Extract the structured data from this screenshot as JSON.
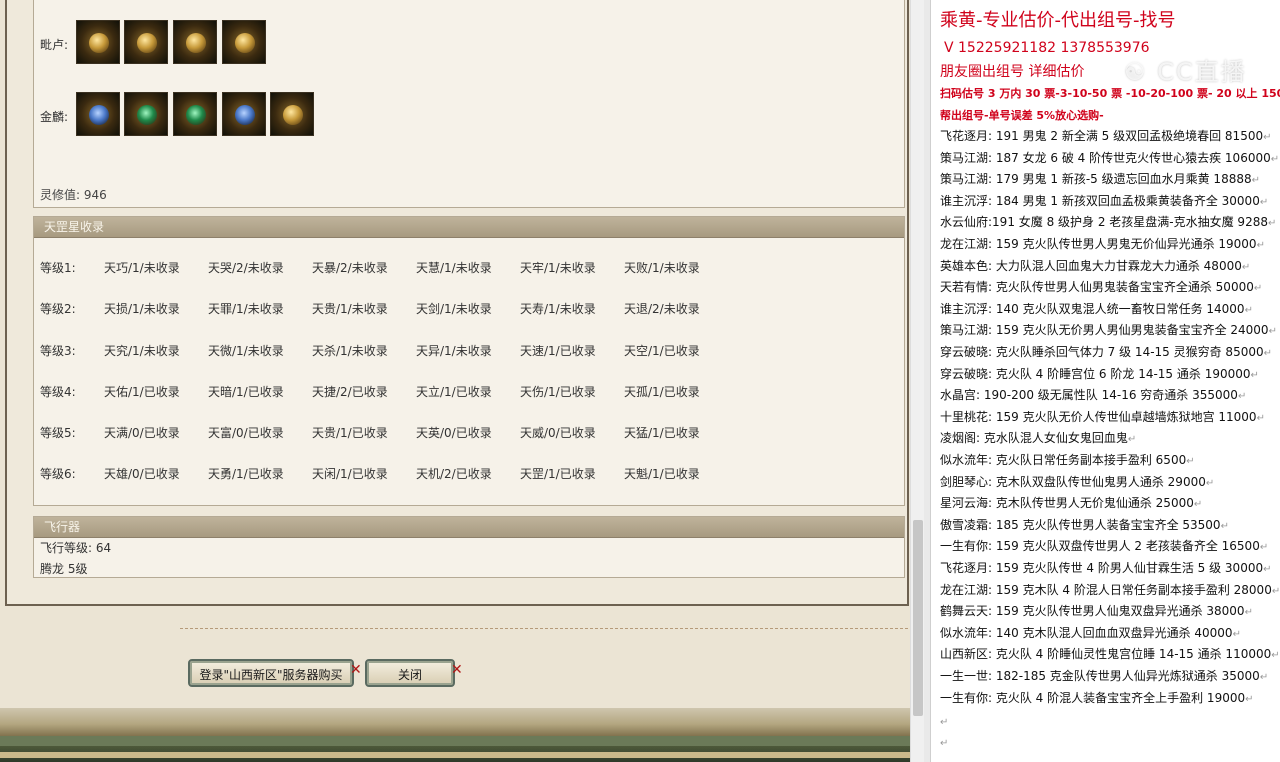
{
  "equipment": {
    "row1_label": "毗卢:",
    "row2_label": "金麟:",
    "lingxiu": "灵修值: 946"
  },
  "tiangang": {
    "title": "天罡星收录",
    "rows": [
      {
        "label": "等级1:",
        "cells": [
          "天巧/1/未收录",
          "天哭/2/未收录",
          "天暴/2/未收录",
          "天慧/1/未收录",
          "天牢/1/未收录",
          "天败/1/未收录"
        ]
      },
      {
        "label": "等级2:",
        "cells": [
          "天损/1/未收录",
          "天罪/1/未收录",
          "天贵/1/未收录",
          "天剑/1/未收录",
          "天寿/1/未收录",
          "天退/2/未收录"
        ]
      },
      {
        "label": "等级3:",
        "cells": [
          "天究/1/未收录",
          "天微/1/未收录",
          "天杀/1/未收录",
          "天异/1/未收录",
          "天速/1/已收录",
          "天空/1/已收录"
        ]
      },
      {
        "label": "等级4:",
        "cells": [
          "天佑/1/已收录",
          "天暗/1/已收录",
          "天捷/2/已收录",
          "天立/1/已收录",
          "天伤/1/已收录",
          "天孤/1/已收录"
        ]
      },
      {
        "label": "等级5:",
        "cells": [
          "天满/0/已收录",
          "天富/0/已收录",
          "天贵/1/已收录",
          "天英/0/已收录",
          "天威/0/已收录",
          "天猛/1/已收录"
        ]
      },
      {
        "label": "等级6:",
        "cells": [
          "天雄/0/已收录",
          "天勇/1/已收录",
          "天闲/1/已收录",
          "天机/2/已收录",
          "天罡/1/已收录",
          "天魁/1/已收录"
        ]
      }
    ]
  },
  "feixing": {
    "title": "飞行器",
    "level": "飞行等级: 64",
    "mount": "腾龙   5级"
  },
  "buttons": {
    "login": "登录\"山西新区\"服务器购买",
    "close": "关闭",
    "x": "✕"
  },
  "notes": {
    "title": "乘黄-专业估价-代出组号-找号",
    "phone": "V 15225921182   1378553976",
    "line3": "朋友圈出组号   详细估价",
    "line4": "扫码估号 3 万内 30 票-3-10-50 票  -10-20-100 票- 20 以上 150",
    "line5": "帮出组号-单号误差 5%放心选购-",
    "watermark": "☯ CC直播",
    "ret": "↵",
    "items": [
      "飞花逐月: 191 男鬼 2 新全满 5 级双回孟极绝境春回 81500",
      "策马江湖: 187 女龙 6 破 4 阶传世克火传世心猿去疾 106000",
      "策马江湖: 179 男鬼 1 新孩-5 级遗忘回血水月乘黄 18888",
      "谁主沉浮: 184 男鬼 1 新孩双回血孟极乘黄装备齐全 30000",
      "水云仙府:191 女魔 8 级护身 2 老孩星盘满-克水抽女魔 9288",
      "龙在江湖: 159 克火队传世男人男鬼无价仙异光通杀 19000",
      "英雄本色: 大力队混人回血鬼大力甘霖龙大力通杀 48000",
      "天若有情: 克火队传世男人仙男鬼装备宝宝齐全通杀 50000",
      "谁主沉浮: 140 克火队双鬼混人统一畜牧日常任务 14000",
      "策马江湖: 159 克火队无价男人男仙男鬼装备宝宝齐全 24000",
      "穿云破晓: 克火队睡杀回气体力 7 级 14-15 灵猴穷奇 85000",
      "穿云破晓: 克火队 4 阶睡宫位 6 阶龙 14-15 通杀 190000",
      "水晶宫: 190-200 级无属性队 14-16 穷奇通杀 355000",
      "十里桃花: 159 克火队无价人传世仙卓越墙炼狱地宫 11000",
      "凌烟阁: 克水队混人女仙女鬼回血鬼",
      "似水流年: 克火队日常任务副本接手盈利 6500",
      "剑胆琴心: 克木队双盘队传世仙鬼男人通杀 29000",
      "星河云海: 克木队传世男人无价鬼仙通杀 25000",
      "傲雪凌霜: 185 克火队传世男人装备宝宝齐全 53500",
      "一生有你: 159 克火队双盘传世男人 2 老孩装备齐全 16500",
      "飞花逐月: 159 克火队传世 4 阶男人仙甘霖生活 5 级 30000",
      "龙在江湖: 159 克木队 4 阶混人日常任务副本接手盈利 28000",
      "鹤舞云天: 159 克火队传世男人仙鬼双盘异光通杀 38000",
      "似水流年: 140 克木队混人回血血双盘异光通杀 40000",
      "山西新区: 克火队 4 阶睡仙灵性鬼宫位睡 14-15 通杀 110000",
      "一生一世: 182-185 克金队传世男人仙异光炼狱通杀 35000",
      "一生有你: 克火队 4 阶混人装备宝宝齐全上手盈利 19000"
    ]
  }
}
